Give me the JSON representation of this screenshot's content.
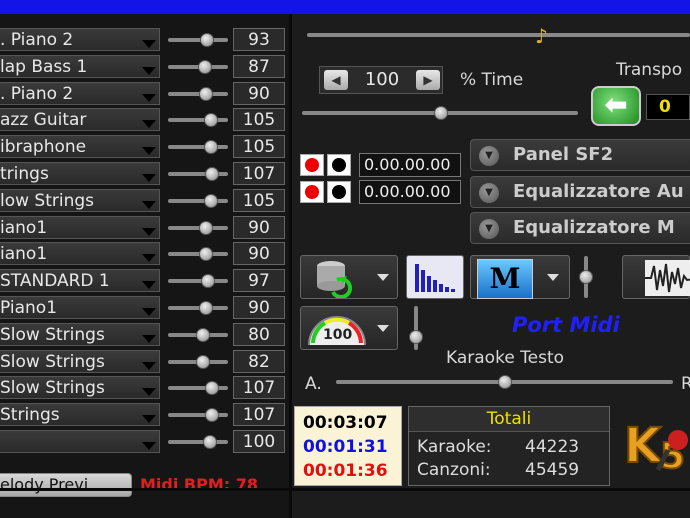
{
  "channels": [
    {
      "name": ". Piano 2",
      "value": "93",
      "slider": 0.65
    },
    {
      "name": "lap Bass 1",
      "value": "87",
      "slider": 0.62
    },
    {
      "name": ". Piano 2",
      "value": "90",
      "slider": 0.64
    },
    {
      "name": "azz Guitar",
      "value": "105",
      "slider": 0.72
    },
    {
      "name": "ibraphone",
      "value": "105",
      "slider": 0.72
    },
    {
      "name": "trings",
      "value": "107",
      "slider": 0.73
    },
    {
      "name": "low Strings",
      "value": "105",
      "slider": 0.72
    },
    {
      "name": "iano1",
      "value": "90",
      "slider": 0.64
    },
    {
      "name": "iano1",
      "value": "90",
      "slider": 0.64
    },
    {
      "name": "STANDARD 1",
      "value": "97",
      "slider": 0.67
    },
    {
      "name": "Piano1",
      "value": "90",
      "slider": 0.64
    },
    {
      "name": "Slow Strings",
      "value": "80",
      "slider": 0.58
    },
    {
      "name": "Slow Strings",
      "value": "82",
      "slider": 0.59
    },
    {
      "name": "Slow Strings",
      "value": "107",
      "slider": 0.73
    },
    {
      "name": "Strings",
      "value": "107",
      "slider": 0.73
    },
    {
      "name": "",
      "value": "100",
      "slider": 0.7
    }
  ],
  "melody_button": "elody Previ...",
  "midi_bpm": "Midi BPM: 78",
  "tempo": {
    "value": "100",
    "label": "% Time"
  },
  "transpose": {
    "label": "Transpo",
    "value": "0"
  },
  "timecodes": [
    "0.00.00.00",
    "0.00.00.00"
  ],
  "panels": [
    "Panel SF2",
    "Equalizzatore Au",
    "Equalizzatore M"
  ],
  "port_midi": "Port Midi",
  "karaoke_testo": "Karaoke Testo",
  "balance": {
    "left": "A.",
    "right": "R"
  },
  "meter_value": "100",
  "clock": {
    "t1": "00:03:07",
    "t2": "00:01:31",
    "t3": "00:01:36"
  },
  "totali": {
    "title": "Totali",
    "karaoke_label": "Karaoke:",
    "karaoke_value": "44223",
    "canzoni_label": "Canzoni:",
    "canzoni_value": "45459"
  },
  "colors": {
    "accent_blue": "#1414e6",
    "bpm_red": "#e02020",
    "port_midi_blue": "#2020ff",
    "totali_yellow": "#f0e000"
  }
}
